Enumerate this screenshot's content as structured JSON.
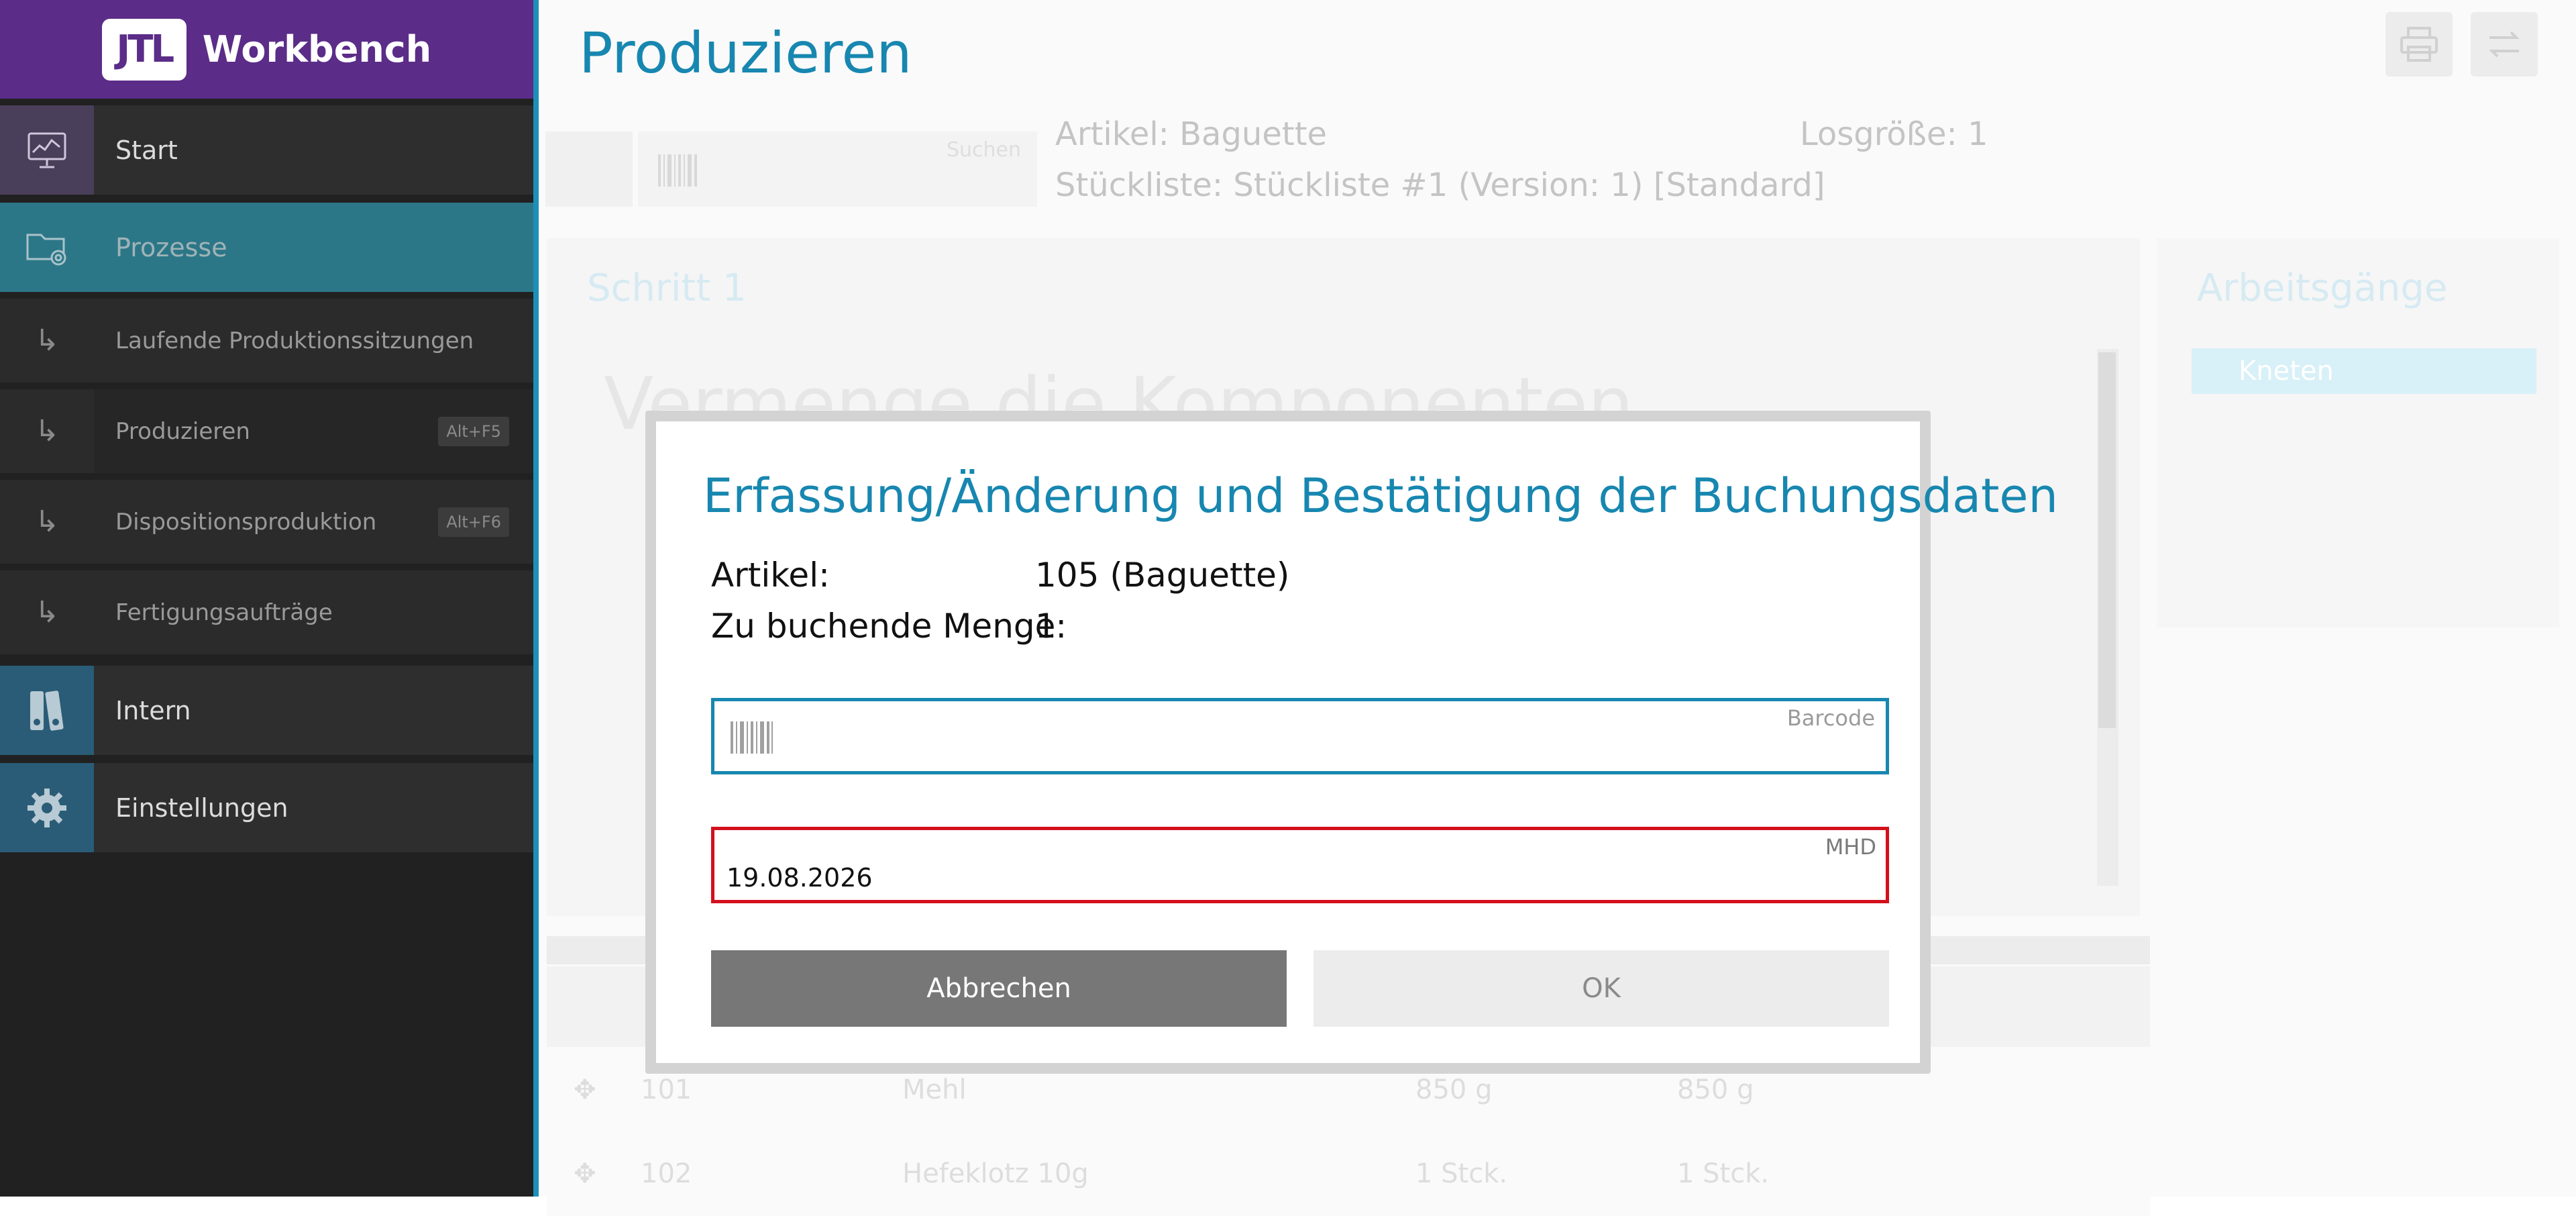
{
  "brand": {
    "logo_text": "JTL",
    "title": "Workbench"
  },
  "sidebar": {
    "items": [
      {
        "label": "Start"
      },
      {
        "label": "Prozesse"
      },
      {
        "label": "Laufende Produktionssitzungen"
      },
      {
        "label": "Produzieren",
        "shortcut": "Alt+F5"
      },
      {
        "label": "Dispositionsproduktion",
        "shortcut": "Alt+F6"
      },
      {
        "label": "Fertigungsaufträge"
      },
      {
        "label": "Intern"
      },
      {
        "label": "Einstellungen"
      }
    ],
    "sub_arrow": "↳"
  },
  "header": {
    "title": "Produzieren",
    "search_placeholder": "Suchen",
    "artikel": "Artikel: Baguette",
    "stueckliste": "Stückliste: Stückliste #1 (Version: 1) [Standard]",
    "losgroesse": "Losgröße: 1"
  },
  "step": {
    "title": "Schritt 1",
    "heading": "Vermenge die Komponenten"
  },
  "operations": {
    "title": "Arbeitsgänge",
    "items": [
      {
        "label": "Kneten"
      }
    ]
  },
  "table": {
    "rows": [
      {
        "pos": "✥",
        "nr": "101",
        "name": "Mehl",
        "qty1": "850 g",
        "qty2": "850 g"
      },
      {
        "pos": "✥",
        "nr": "102",
        "name": "Hefeklotz 10g",
        "qty1": "1 Stck.",
        "qty2": "1 Stck."
      }
    ]
  },
  "dialog": {
    "title": "Erfassung/Änderung und Bestätigung der Buchungsdaten",
    "artikel_label": "Artikel:",
    "artikel_value": "105 (Baguette)",
    "menge_label": "Zu buchende Menge:",
    "menge_value": "1",
    "barcode_label": "Barcode",
    "barcode_value": "",
    "mhd_label": "MHD",
    "mhd_value": "19.08.2026",
    "cancel_label": "Abbrechen",
    "ok_label": "OK"
  },
  "colors": {
    "brand": "#5b2c88",
    "accent": "#1787b0",
    "error": "#d4101c",
    "sidebar_bg": "#212121"
  }
}
